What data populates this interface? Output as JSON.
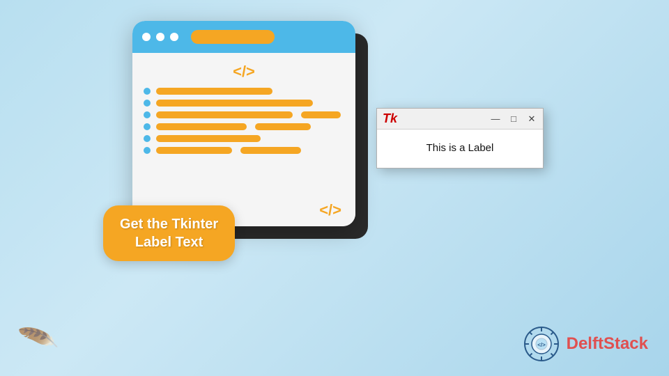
{
  "background": {
    "gradient_start": "#b8dff0",
    "gradient_end": "#a8d5eb"
  },
  "editor": {
    "titlebar_color": "#4db8e8",
    "tag_open": "</>",
    "tag_close": "</>",
    "code_color": "#f5a623",
    "dot_color": "#4db8e8",
    "dots": [
      "●",
      "●",
      "●"
    ],
    "lines": [
      {
        "width": "60%"
      },
      {
        "width": "80%"
      },
      {
        "width": "70%"
      },
      {
        "width": "85%"
      },
      {
        "width": "55%"
      },
      {
        "width": "65%"
      }
    ]
  },
  "popup": {
    "icon_label": "Tk",
    "label_text": "This is a Label",
    "minimize_char": "—",
    "maximize_char": "□",
    "close_char": "✕"
  },
  "promo_badge": {
    "line1": "Get the Tkinter",
    "line2": "Label Text"
  },
  "feather": {
    "char": "🪶"
  },
  "logo": {
    "brand_part1": "Delft",
    "brand_part2": "Stack",
    "emblem_label": "Delft Stack emblem"
  }
}
